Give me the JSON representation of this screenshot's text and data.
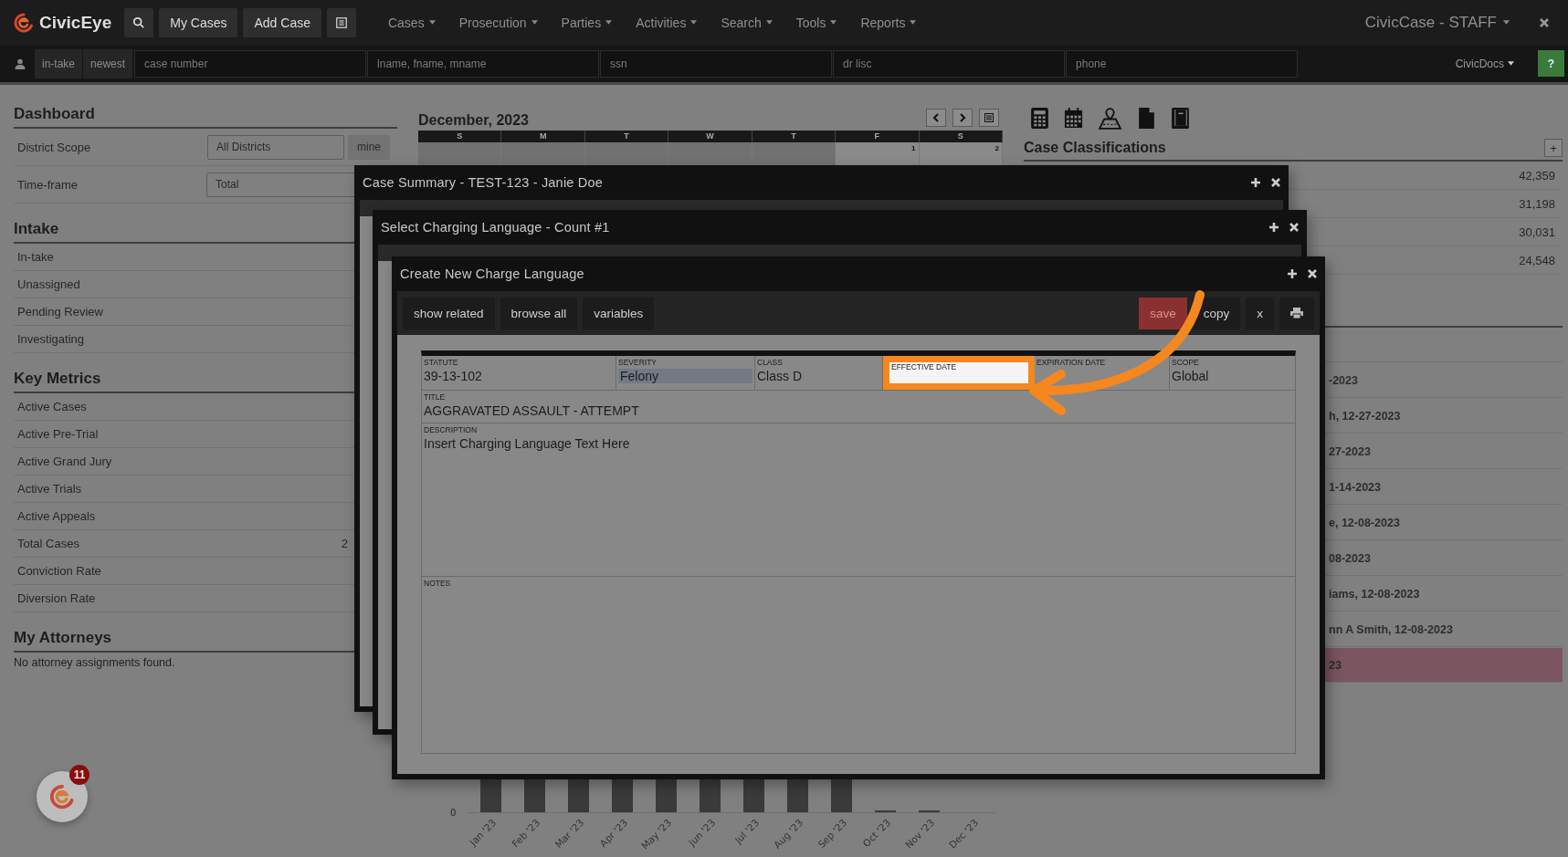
{
  "app": {
    "logo": "CivicEye",
    "buttons": [
      "My Cases",
      "Add Case"
    ],
    "menu": [
      "Cases",
      "Prosecution",
      "Parties",
      "Activities",
      "Search",
      "Tools",
      "Reports"
    ],
    "account": "CivicCase - STAFF"
  },
  "search_bar": {
    "filters": [
      "in-take",
      "newest"
    ],
    "fields": [
      {
        "placeholder": "case number"
      },
      {
        "placeholder": "lname, fname, mname"
      },
      {
        "placeholder": "ssn"
      },
      {
        "placeholder": "dr lisc"
      },
      {
        "placeholder": "phone"
      }
    ],
    "docs": "CivicDocs",
    "help": "?"
  },
  "dashboard": {
    "title": "Dashboard",
    "settings": [
      {
        "label": "District Scope",
        "value": "All Districts",
        "button": "mine"
      },
      {
        "label": "Time-frame",
        "value": "Total"
      }
    ],
    "sections": [
      {
        "title": "Intake",
        "rows": [
          {
            "label": "In-take"
          },
          {
            "label": "Unassigned"
          },
          {
            "label": "Pending Review"
          },
          {
            "label": "Investigating"
          }
        ]
      },
      {
        "title": "Key Metrics",
        "rows": [
          {
            "label": "Active Cases"
          },
          {
            "label": "Active Pre-Trial"
          },
          {
            "label": "Active Grand Jury"
          },
          {
            "label": "Active Trials"
          },
          {
            "label": "Active Appeals"
          },
          {
            "label": "Total Cases",
            "value": "2"
          },
          {
            "label": "Conviction Rate"
          },
          {
            "label": "Diversion Rate"
          }
        ]
      },
      {
        "title": "My Attorneys",
        "note": "No attorney assignments found."
      }
    ]
  },
  "calendar": {
    "title": "December, 2023",
    "weekdays": [
      "S",
      "M",
      "T",
      "W",
      "T",
      "F",
      "S"
    ],
    "cells": [
      {
        "in_month": false
      },
      {
        "in_month": false
      },
      {
        "in_month": false
      },
      {
        "in_month": false
      },
      {
        "in_month": false
      },
      {
        "in_month": true,
        "date": "1"
      },
      {
        "in_month": true,
        "date": "2"
      }
    ]
  },
  "chart": {
    "y_tick": "0",
    "months": [
      {
        "label": "Jan '23",
        "kind": "tall"
      },
      {
        "label": "Feb '23",
        "kind": "tall"
      },
      {
        "label": "Mar '23",
        "kind": "tall"
      },
      {
        "label": "Apr '23",
        "kind": "tall"
      },
      {
        "label": "May '23",
        "kind": "tall"
      },
      {
        "label": "Jun '23",
        "kind": "tall"
      },
      {
        "label": "Jul '23",
        "kind": "tall"
      },
      {
        "label": "Aug '23",
        "kind": "tall"
      },
      {
        "label": "Sep '23",
        "kind": "tall"
      },
      {
        "label": "Oct '23",
        "kind": "tiny"
      },
      {
        "label": "Nov '23",
        "kind": "tiny"
      },
      {
        "label": "Dec '23",
        "kind": "none"
      }
    ]
  },
  "case_classifications": {
    "title": "Case Classifications",
    "add": "+",
    "counts": [
      "42,359",
      "31,198",
      "30,031",
      "24,548"
    ]
  },
  "recent": [
    {
      "text": "-2023",
      "highlighted": false
    },
    {
      "text": "h, 12-27-2023",
      "highlighted": false
    },
    {
      "text": "27-2023",
      "highlighted": false
    },
    {
      "text": "1-14-2023",
      "highlighted": false
    },
    {
      "text": "e, 12-08-2023",
      "highlighted": false
    },
    {
      "text": "08-2023",
      "highlighted": false
    },
    {
      "text": "iams, 12-08-2023",
      "highlighted": false
    },
    {
      "text": "nn A Smith, 12-08-2023",
      "highlighted": false
    },
    {
      "text": "23",
      "highlighted": true
    }
  ],
  "windows": [
    {
      "title": "Case Summary - TEST-123 - Janie Doe"
    },
    {
      "title": "Select Charging Language - Count #1"
    },
    {
      "title": "Create New Charge Language",
      "toolbar": {
        "left": [
          "show related",
          "browse all",
          "variables"
        ],
        "save": "save",
        "copy": "copy",
        "clear": "x"
      },
      "form": {
        "fields": [
          {
            "label": "STATUTE",
            "value": "39-13-102",
            "kind": "text",
            "highlighted": false
          },
          {
            "label": "SEVERITY",
            "value": "Felony",
            "kind": "select",
            "highlighted": false
          },
          {
            "label": "CLASS",
            "value": "Class D",
            "kind": "text",
            "highlighted": false
          },
          {
            "label": "EFFECTIVE DATE",
            "kind": "input",
            "highlighted": true
          },
          {
            "label": "EXPIRATION DATE",
            "kind": "text",
            "highlighted": false
          },
          {
            "label": "SCOPE",
            "value": "Global",
            "kind": "text",
            "highlighted": false
          }
        ],
        "title": {
          "label": "TITLE",
          "value": "AGGRAVATED ASSAULT - ATTEMPT"
        },
        "description": {
          "label": "DESCRIPTION",
          "value": "Insert Charging Language Text Here"
        },
        "notes": {
          "label": "NOTES"
        }
      }
    }
  ],
  "notifications": {
    "count": "11"
  }
}
